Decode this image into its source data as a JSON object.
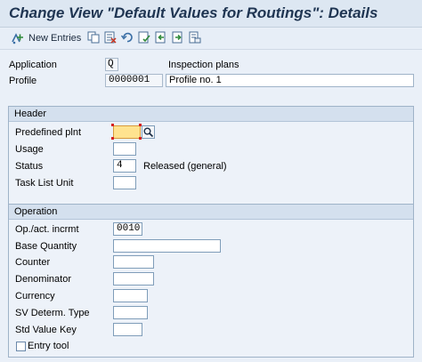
{
  "title": "Change View \"Default Values for Routings\": Details",
  "toolbar": {
    "new_entries_label": "New Entries",
    "icons": [
      "copy-icon",
      "delete-icon",
      "undo-icon",
      "select-all-icon",
      "previous-entry-icon",
      "next-entry-icon",
      "print-icon"
    ]
  },
  "header_fields": {
    "application_label": "Application",
    "application_value": "Q",
    "application_text": "Inspection plans",
    "profile_label": "Profile",
    "profile_value": "0000001",
    "profile_text": "Profile no. 1"
  },
  "header_group": {
    "title": "Header",
    "predefined_plnt_label": "Predefined plnt",
    "predefined_plnt_value": "",
    "usage_label": "Usage",
    "usage_value": "",
    "status_label": "Status",
    "status_value": "4",
    "status_text": "Released (general)",
    "task_list_unit_label": "Task List Unit",
    "task_list_unit_value": ""
  },
  "operation_group": {
    "title": "Operation",
    "op_incrmt_label": "Op./act. incrmt",
    "op_incrmt_value": "0010",
    "base_quantity_label": "Base Quantity",
    "base_quantity_value": "",
    "counter_label": "Counter",
    "counter_value": "",
    "denominator_label": "Denominator",
    "denominator_value": "",
    "currency_label": "Currency",
    "currency_value": "",
    "sv_determ_type_label": "SV Determ. Type",
    "sv_determ_type_value": "",
    "std_value_key_label": "Std Value Key",
    "std_value_key_value": "",
    "entry_tool_label": "Entry tool",
    "entry_tool_checked": false
  },
  "colors": {
    "title": "#1f3552",
    "background": "#eaf0f8",
    "group_header": "#d4e0ee",
    "focused_field": "#ffe38f",
    "field_border": "#7f9db9"
  }
}
